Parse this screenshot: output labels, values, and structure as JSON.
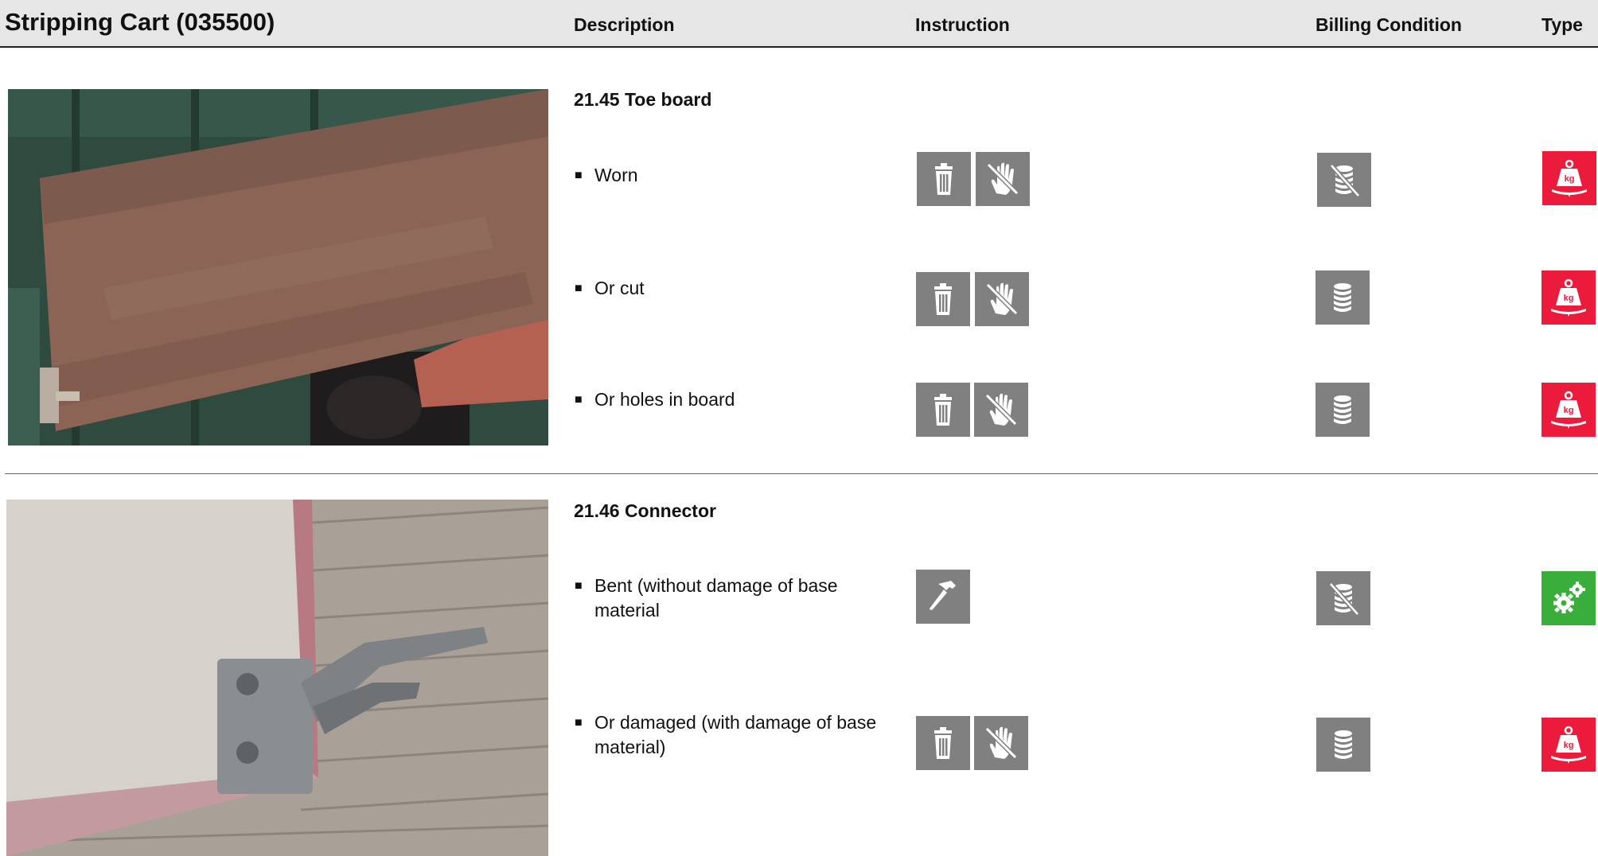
{
  "header": {
    "title": "Stripping Cart (035500)",
    "col_description": "Description",
    "col_instruction": "Instruction",
    "col_billing": "Billing Condition",
    "col_type": "Type"
  },
  "sections": [
    {
      "title": "21.45 Toe board",
      "items": [
        {
          "text": "Worn",
          "instruction": [
            "trash-icon",
            "no-touch-icon"
          ],
          "billing": "no-coins-icon",
          "type": "weight-kg-icon"
        },
        {
          "text": "Or cut",
          "instruction": [
            "trash-icon",
            "no-touch-icon"
          ],
          "billing": "coins-icon",
          "type": "weight-kg-icon"
        },
        {
          "text": "Or holes in board",
          "instruction": [
            "trash-icon",
            "no-touch-icon"
          ],
          "billing": "coins-icon",
          "type": "weight-kg-icon"
        }
      ]
    },
    {
      "title": "21.46 Connector",
      "items": [
        {
          "text": "Bent (without damage of base material",
          "instruction": [
            "hammer-icon"
          ],
          "billing": "no-coins-icon",
          "type": "gears-icon"
        },
        {
          "text": "Or damaged (with damage of base material)",
          "instruction": [
            "trash-icon",
            "no-touch-icon"
          ],
          "billing": "coins-icon",
          "type": "weight-kg-icon"
        }
      ]
    }
  ],
  "bullet_glyph": "■",
  "colors": {
    "icon_grey": "#808080",
    "type_red": "#ec1b3b",
    "type_green": "#3aae3a"
  }
}
